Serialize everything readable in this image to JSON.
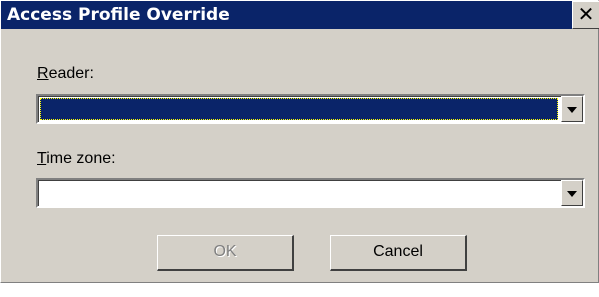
{
  "window": {
    "title": "Access Profile Override",
    "close_glyph": "✕"
  },
  "reader": {
    "label_mnemonic": "R",
    "label_rest": "eader:",
    "value": ""
  },
  "time_zone": {
    "label_mnemonic": "T",
    "label_rest": "ime zone:",
    "value": ""
  },
  "buttons": {
    "ok_label": "OK",
    "cancel_label": "Cancel"
  },
  "colors": {
    "titlebar": "#0a2469",
    "face": "#d4d0c8",
    "selection": "#0a2469"
  },
  "icons": {
    "close": "close-icon",
    "dropdown": "chevron-down-icon"
  }
}
